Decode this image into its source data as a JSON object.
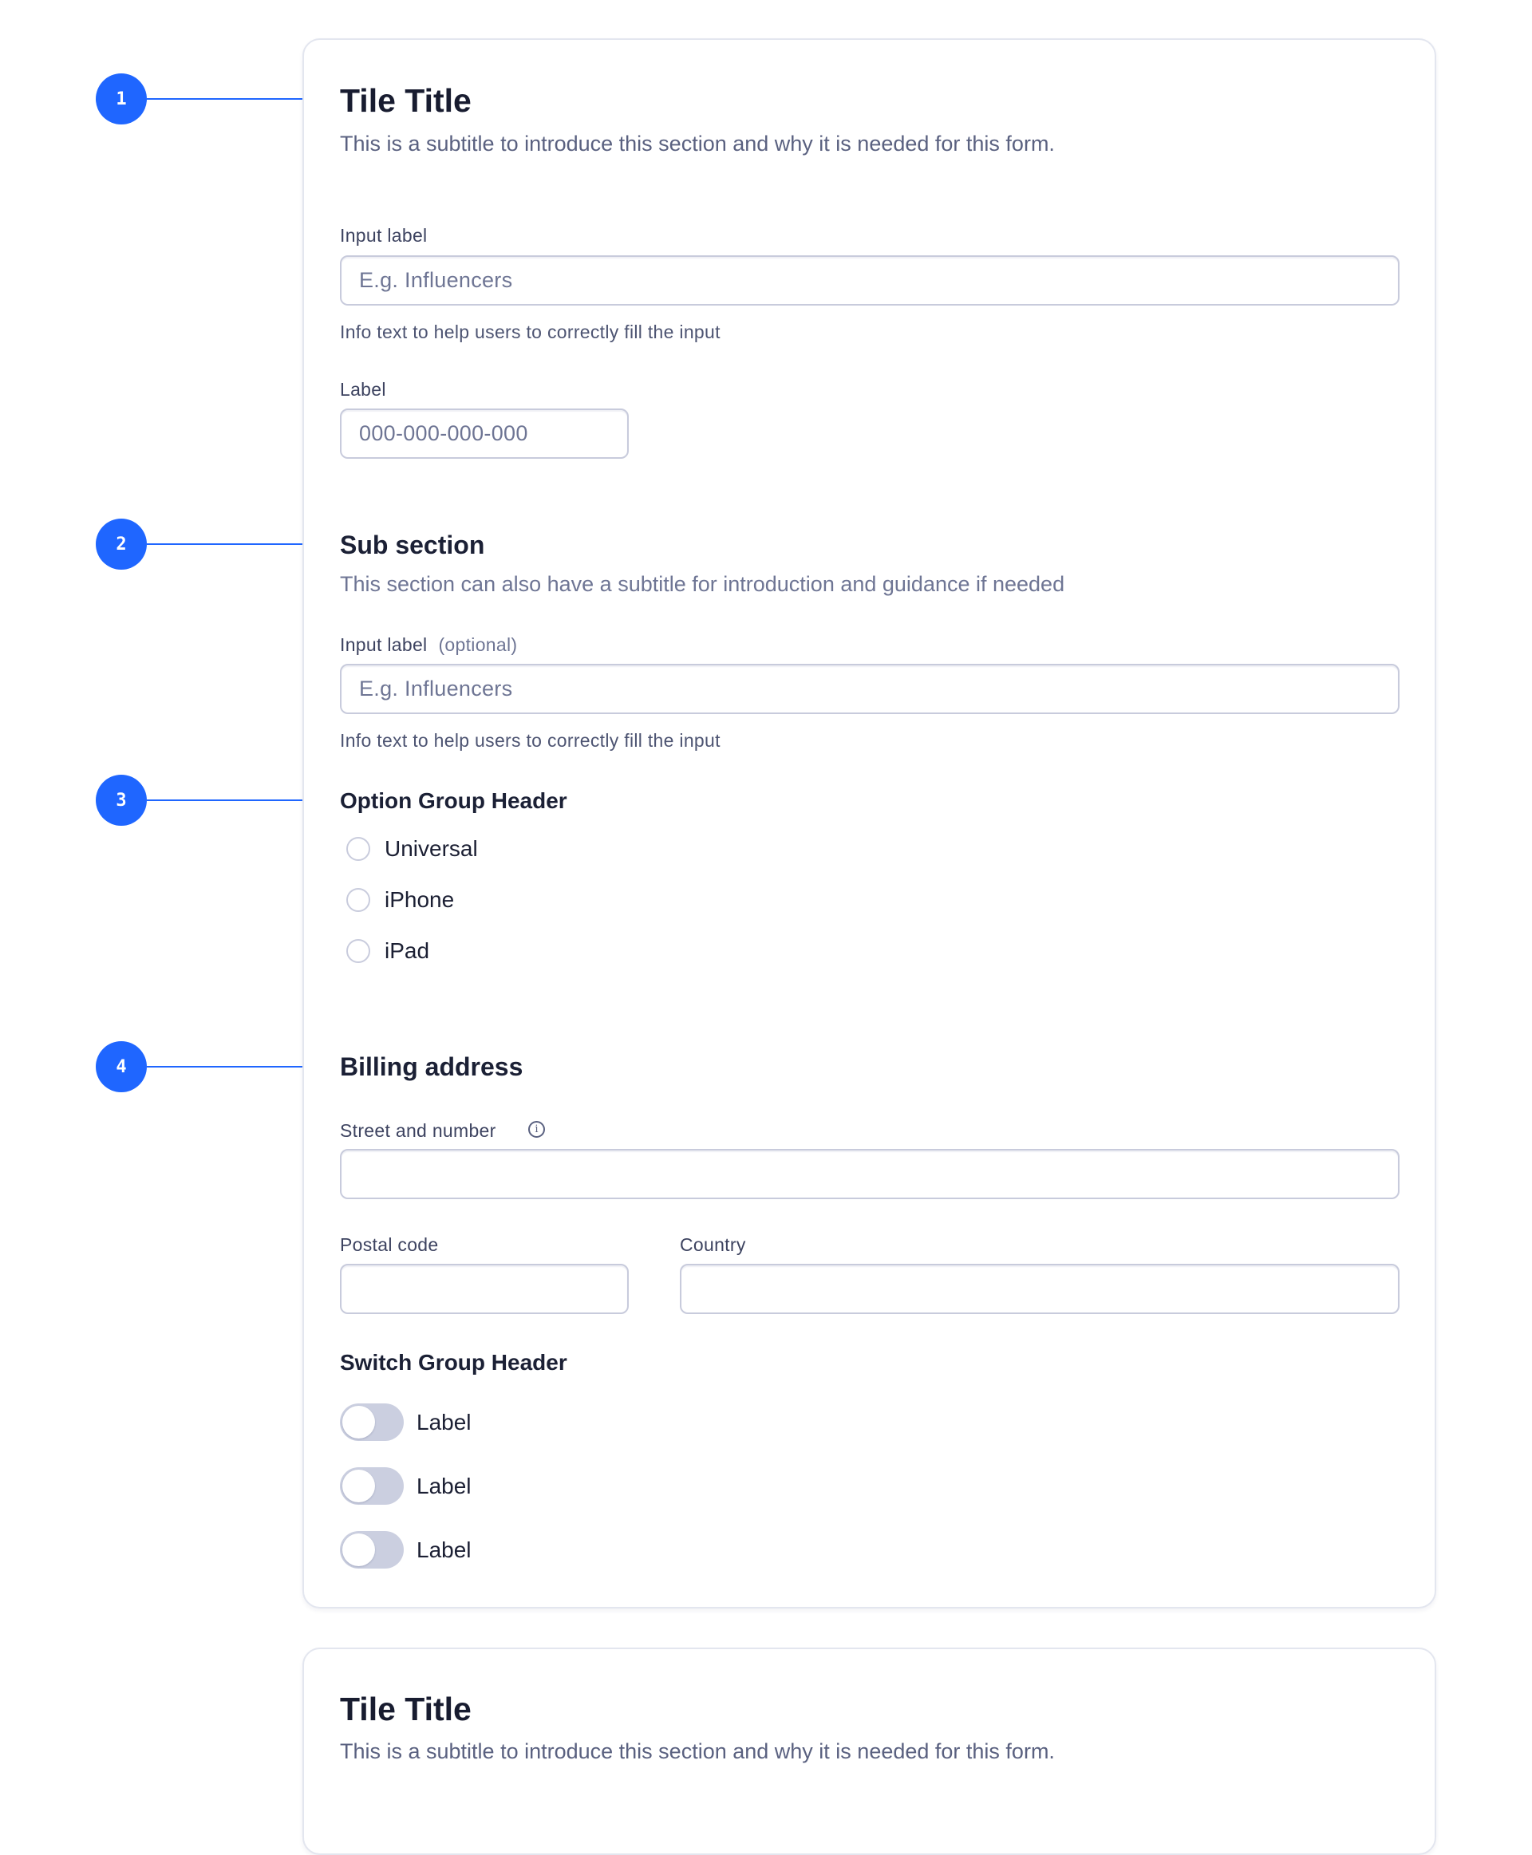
{
  "colors": {
    "accent": "#1F66FF",
    "card_border": "#E3E6EF",
    "input_border": "#C8CBDC",
    "toggle_off": "#CBCFE0"
  },
  "annotations": [
    {
      "number": "1"
    },
    {
      "number": "2"
    },
    {
      "number": "3"
    },
    {
      "number": "4"
    }
  ],
  "tile1": {
    "title": "Tile Title",
    "subtitle": "This is a subtitle to introduce this section and why it is needed for this form.",
    "field1": {
      "label": "Input label",
      "placeholder": "E.g. Influencers",
      "info": "Info text to help users to correctly fill the input"
    },
    "field2": {
      "label": "Label",
      "placeholder": "000-000-000-000"
    },
    "subsection": {
      "title": "Sub section",
      "subtitle": "This section can also have a subtitle for introduction and guidance if needed",
      "field": {
        "label": "Input label",
        "optional": "(optional)",
        "placeholder": "E.g. Influencers",
        "info": "Info text to help users to correctly fill the input"
      }
    },
    "option_group": {
      "header": "Option Group Header",
      "options": [
        {
          "label": "Universal",
          "selected": false
        },
        {
          "label": "iPhone",
          "selected": false
        },
        {
          "label": "iPad",
          "selected": false
        }
      ]
    },
    "billing": {
      "title": "Billing address",
      "street_label": "Street and number",
      "street_value": "",
      "info_icon": "info-icon",
      "postal_label": "Postal code",
      "postal_value": "",
      "country_label": "Country",
      "country_value": ""
    },
    "switch_group": {
      "header": "Switch Group Header",
      "switches": [
        {
          "label": "Label",
          "on": false
        },
        {
          "label": "Label",
          "on": false
        },
        {
          "label": "Label",
          "on": false
        }
      ]
    }
  },
  "tile2": {
    "title": "Tile Title",
    "subtitle": "This is a subtitle to introduce this section and why it is needed for this form."
  }
}
